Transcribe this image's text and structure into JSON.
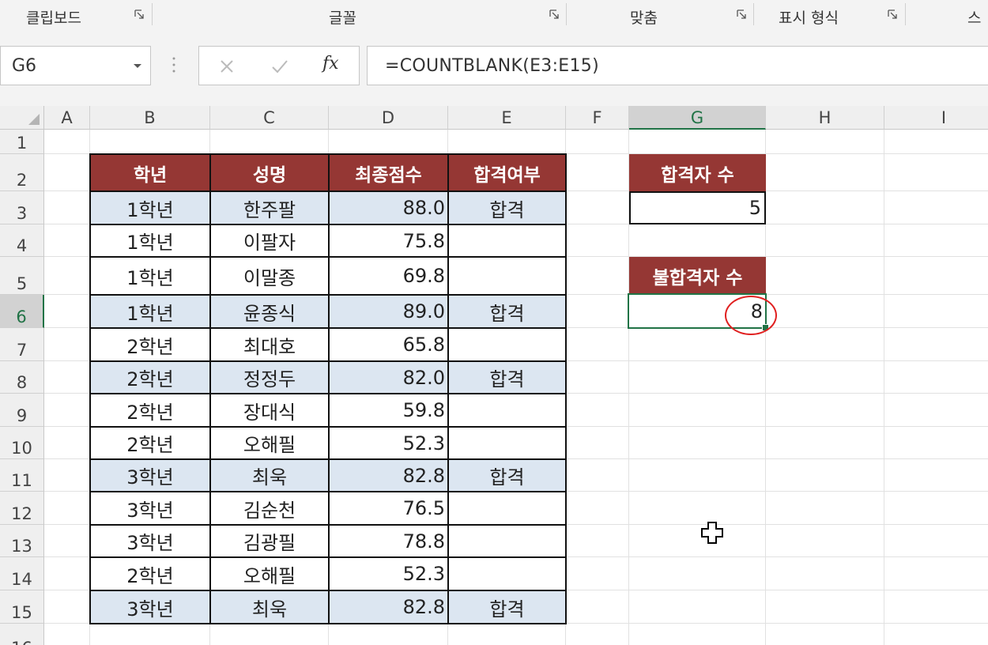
{
  "ribbon": {
    "groups": [
      {
        "label": "클립보드"
      },
      {
        "label": "글꼴"
      },
      {
        "label": "맞춤"
      },
      {
        "label": "표시 형식"
      },
      {
        "label": "스"
      }
    ]
  },
  "formula_bar": {
    "name_box": "G6",
    "formula": "=COUNTBLANK(E3:E15)",
    "fx_label": "fx"
  },
  "columns": [
    "A",
    "B",
    "C",
    "D",
    "E",
    "F",
    "G",
    "H",
    "I"
  ],
  "rows": [
    "1",
    "2",
    "3",
    "4",
    "5",
    "6",
    "7",
    "8",
    "9",
    "10",
    "11",
    "12",
    "13",
    "14",
    "15",
    "16"
  ],
  "table": {
    "headers": [
      "학년",
      "성명",
      "최종점수",
      "합격여부"
    ],
    "rows": [
      {
        "grade": "1학년",
        "name": "한주팔",
        "score": "88.0",
        "result": "합격"
      },
      {
        "grade": "1학년",
        "name": "이팔자",
        "score": "75.8",
        "result": ""
      },
      {
        "grade": "1학년",
        "name": "이말종",
        "score": "69.8",
        "result": ""
      },
      {
        "grade": "1학년",
        "name": "윤종식",
        "score": "89.0",
        "result": "합격"
      },
      {
        "grade": "2학년",
        "name": "최대호",
        "score": "65.8",
        "result": ""
      },
      {
        "grade": "2학년",
        "name": "정정두",
        "score": "82.0",
        "result": "합격"
      },
      {
        "grade": "2학년",
        "name": "장대식",
        "score": "59.8",
        "result": ""
      },
      {
        "grade": "2학년",
        "name": "오해필",
        "score": "52.3",
        "result": ""
      },
      {
        "grade": "3학년",
        "name": "최욱",
        "score": "82.8",
        "result": "합격"
      },
      {
        "grade": "3학년",
        "name": "김순천",
        "score": "76.5",
        "result": ""
      },
      {
        "grade": "3학년",
        "name": "김광필",
        "score": "78.8",
        "result": ""
      },
      {
        "grade": "2학년",
        "name": "오해필",
        "score": "52.3",
        "result": ""
      },
      {
        "grade": "3학년",
        "name": "최욱",
        "score": "82.8",
        "result": "합격"
      }
    ]
  },
  "summary": {
    "pass_label": "합격자 수",
    "pass_value": "5",
    "fail_label": "불합격자 수",
    "fail_value": "8"
  },
  "colors": {
    "header_fill": "#953734",
    "band_fill": "#dce6f1",
    "selection": "#217346",
    "highlight_circle": "#e02020"
  },
  "icons": [
    "dialog-launcher-icon",
    "dropdown-arrow-icon",
    "cancel-x-icon",
    "enter-check-icon",
    "function-fx-icon",
    "plus-cursor-icon"
  ]
}
